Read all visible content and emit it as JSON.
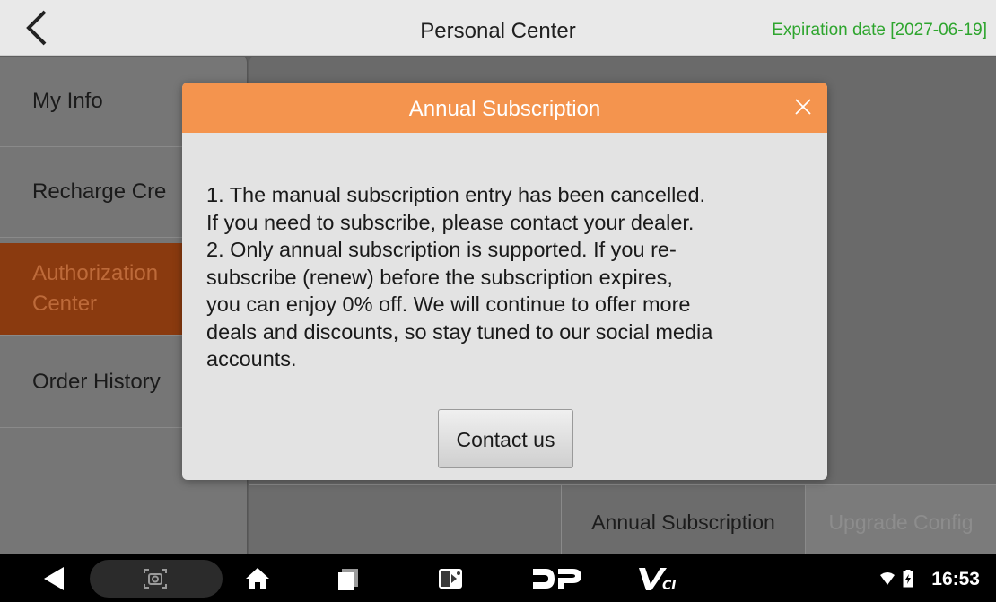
{
  "header": {
    "title": "Personal Center",
    "expiration": "Expiration date [2027-06-19]"
  },
  "sidebar": {
    "items": [
      {
        "label": "My Info",
        "active": false
      },
      {
        "label": "Recharge Cre",
        "active": false
      },
      {
        "label": "Authorization Center",
        "active": true
      },
      {
        "label": "Order History",
        "active": false
      }
    ]
  },
  "tabs": {
    "annual": "Annual Subscription",
    "upgrade": "Upgrade Config"
  },
  "dialog": {
    "title": "Annual Subscription",
    "lines": [
      "1. The manual subscription entry has been cancelled.",
      "If you need to subscribe, please contact your dealer.",
      "2. Only annual subscription is supported. If you re-",
      "subscribe (renew) before the subscription expires,",
      "you can enjoy 0% off. We will continue to offer more",
      "deals and discounts, so stay tuned to our social media",
      "accounts."
    ],
    "button": "Contact us"
  },
  "navbar": {
    "time": "16:53"
  },
  "icons": {
    "back": "back-chevron-icon",
    "close": "close-icon",
    "nav_back": "nav-back-icon",
    "screenshot": "screenshot-icon",
    "home": "home-icon",
    "recents": "recents-icon",
    "dp": "dp-logo-icon",
    "vci": "vci-icon",
    "wifi": "wifi-icon",
    "battery": "battery-icon"
  },
  "colors": {
    "accent": "#f4944e",
    "expiry": "#2ea52e",
    "active_item": "#8a3a0f"
  }
}
